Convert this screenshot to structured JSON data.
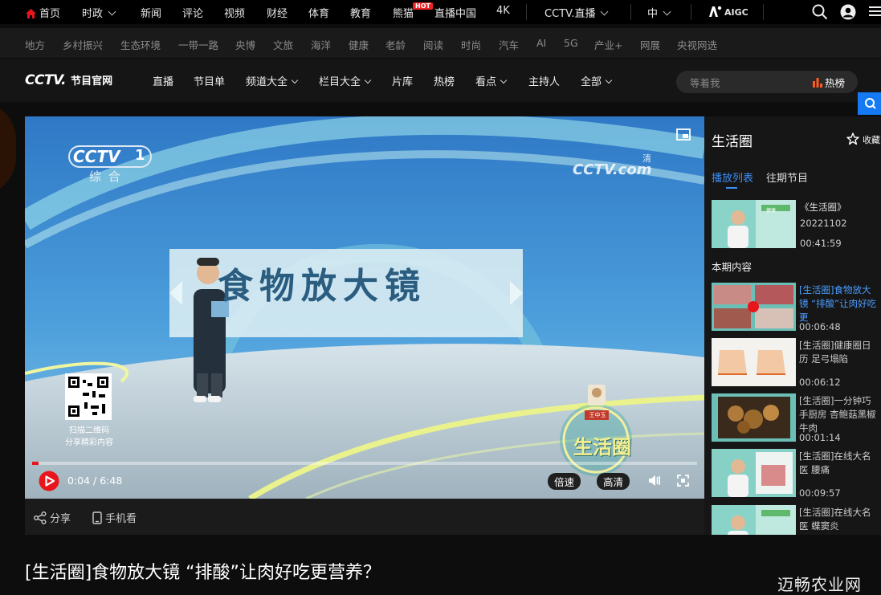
{
  "top_nav": {
    "items": [
      "首页",
      "时政",
      "新闻",
      "评论",
      "视频",
      "财经",
      "体育",
      "教育",
      "熊猫",
      "直播中国",
      "4K",
      "CCTV.直播",
      "中",
      "AIGC"
    ],
    "hot_badge": "HOT"
  },
  "sub_nav": {
    "items": [
      "地方",
      "乡村振兴",
      "生态环境",
      "一带一路",
      "央博",
      "文旅",
      "海洋",
      "健康",
      "老龄",
      "阅读",
      "时尚",
      "汽车",
      "AI",
      "5G",
      "产业+",
      "网展",
      "央视网选"
    ]
  },
  "channel_bar": {
    "logo_text": "CCTV.",
    "logo_sub": "节目官网",
    "items": [
      "直播",
      "节目单",
      "频道大全",
      "栏目大全",
      "片库",
      "热榜",
      "看点",
      "主持人",
      "全部"
    ],
    "search_placeholder": "等着我",
    "hot_rank": "热榜"
  },
  "player": {
    "channel_logo": "CCTV",
    "channel_number": "1",
    "channel_name": "综 合",
    "watermark": "CCTV.com",
    "watermark_hd": "清",
    "screen_text": "食物放大镜",
    "qr_caption_1": "扫描二维码",
    "qr_caption_2": "分享精彩内容",
    "show_logo": "生活圈",
    "badge_text": "王中玉",
    "time": "0:04 / 6:48",
    "progress": 0.0098,
    "speed_label": "倍速",
    "quality_label": "高清"
  },
  "share_bar": {
    "share_label": "分享",
    "mobile_label": "手机看"
  },
  "video_title": "[生活圈]食物放大镜 “排酸”让肉好吃更营养？",
  "page_watermark": "迈畅农业网",
  "side_panel": {
    "title": "生活圈",
    "collect_label": "收藏",
    "tabs": [
      "播放列表",
      "往期节目"
    ],
    "episode": {
      "name": "《生活圈》",
      "date": "20221102",
      "duration": "00:41:59",
      "thumb_caption": "健康"
    },
    "section_title": "本期内容",
    "items": [
      {
        "title": "[生活圈]食物放大镜 “排酸”让肉好吃更",
        "duration": "00:06:48",
        "active": true
      },
      {
        "title": "[生活圈]健康圈日历 足弓塌陷",
        "duration": "00:06:12",
        "active": false
      },
      {
        "title": "[生活圈]一分钟巧手厨房 杏鲍菇黑椒牛肉",
        "duration": "00:01:14",
        "active": false
      },
      {
        "title": "[生活圈]在线大名医 腰痛",
        "duration": "00:09:57",
        "active": false
      },
      {
        "title": "[生活圈]在线大名医 蝶窦炎",
        "duration": "",
        "active": false
      }
    ]
  },
  "colors": {
    "accent_red": "#e8151b",
    "link_blue": "#3d8ef5",
    "active_item": "#4a9dff",
    "search_blue": "#1479f2",
    "hot_orange": "#ff5a1f"
  }
}
